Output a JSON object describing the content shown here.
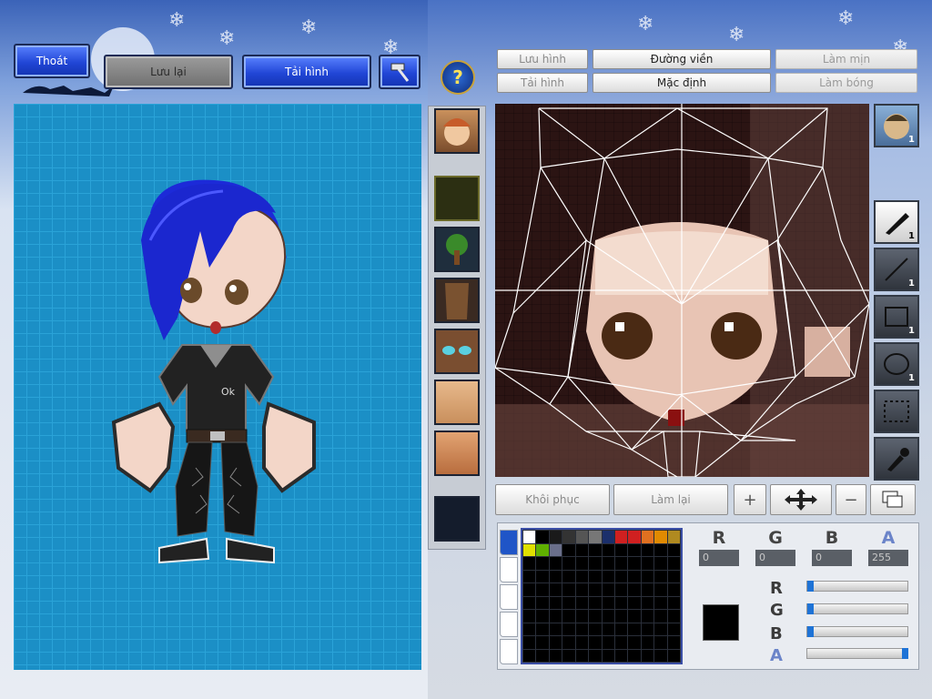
{
  "toolbar_left": {
    "exit_label": "Thoát",
    "save_label": "Lưu lại",
    "reload_label": "Tải hình"
  },
  "editor_top": {
    "save_image_label": "Lưu hình",
    "outline_label": "Đường viền",
    "smooth_label": "Làm mịn",
    "load_image_label": "Tải hình",
    "default_label": "Mặc định",
    "shade_label": "Làm bóng"
  },
  "editor_bottom": {
    "restore_label": "Khôi phục",
    "redo_label": "Làm lại"
  },
  "tools": {
    "pen_count": "1",
    "line_count": "1",
    "rect_count": "1",
    "ellipse_count": "1",
    "preview_count": "1"
  },
  "color": {
    "channels": [
      "R",
      "G",
      "B",
      "A"
    ],
    "r_value": "0",
    "g_value": "0",
    "b_value": "0",
    "a_value": "255",
    "current": "#000000",
    "swatches": [
      "#ffffff",
      "#000000",
      "#1a1a1a",
      "#333333",
      "#555555",
      "#777777",
      "#1b2f6b",
      "#d02020",
      "#d02020",
      "#e07020",
      "#e08a00",
      "#b08a20",
      "#e0e000",
      "#5fb000",
      "#6a6f8a"
    ]
  },
  "colors": {
    "canvas_bg": "#1b8fc6",
    "accent_blue": "#2146d6"
  }
}
